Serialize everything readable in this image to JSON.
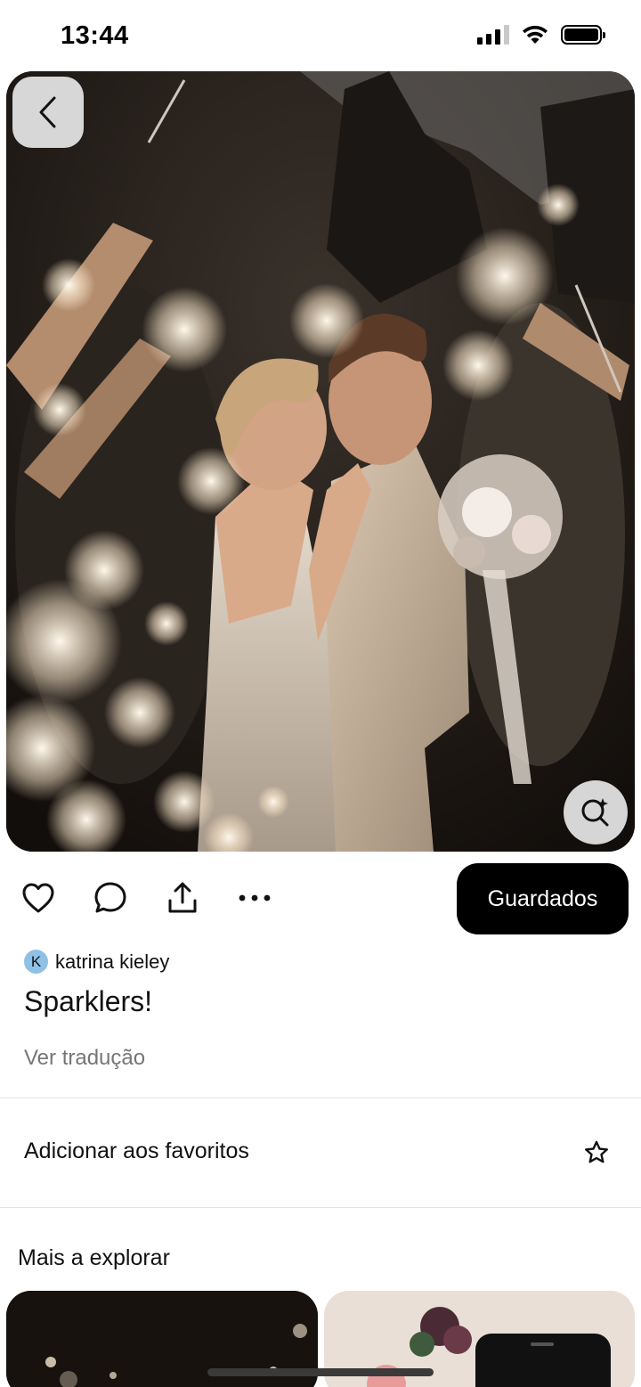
{
  "status_bar": {
    "time": "13:44",
    "icons": [
      "signal-icon",
      "wifi-icon",
      "battery-icon"
    ]
  },
  "pin": {
    "image_alt": "Casal de noivos a beijar-se rodeado de convidados com velas de faísca",
    "author": {
      "avatar_initial": "K",
      "name": "katrina kieley"
    },
    "title": "Sparklers!",
    "translate_link": "Ver tradução"
  },
  "actions": {
    "icons": [
      "heart-icon",
      "comment-icon",
      "share-icon",
      "more-icon"
    ],
    "save_label": "Guardados"
  },
  "favorites": {
    "label": "Adicionar aos favoritos"
  },
  "explore": {
    "heading": "Mais a explorar"
  },
  "colors": {
    "primary_button": "#000000",
    "muted_text": "#767676",
    "avatar_bg": "#8fc1e6",
    "divider": "#e3e3e3"
  }
}
